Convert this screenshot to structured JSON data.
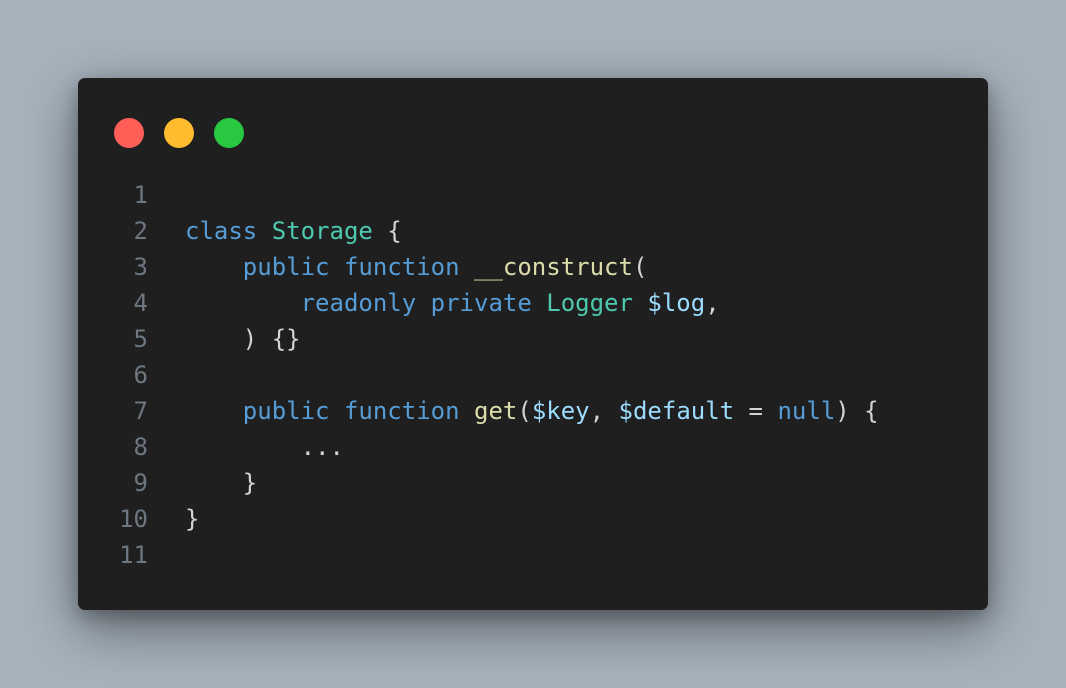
{
  "window": {
    "controls": {
      "close_color": "#ff5f57",
      "minimize_color": "#febc2e",
      "maximize_color": "#28c840"
    }
  },
  "theme": {
    "background": "#1f1f1f",
    "text": "#d4d4d4",
    "line_number": "#6e7681",
    "keyword": "#569cd6",
    "type": "#4ec9b0",
    "function": "#dcdcaa",
    "variable": "#9cdcfe"
  },
  "code": {
    "lines": [
      {
        "number": "1",
        "tokens": []
      },
      {
        "number": "2",
        "tokens": [
          {
            "t": "class",
            "k": "keyword"
          },
          {
            "t": " ",
            "k": "plain"
          },
          {
            "t": "Storage",
            "k": "type"
          },
          {
            "t": " {",
            "k": "plain"
          }
        ]
      },
      {
        "number": "3",
        "tokens": [
          {
            "t": "    ",
            "k": "plain"
          },
          {
            "t": "public",
            "k": "keyword"
          },
          {
            "t": " ",
            "k": "plain"
          },
          {
            "t": "function",
            "k": "keyword"
          },
          {
            "t": " ",
            "k": "plain"
          },
          {
            "t": "__construct",
            "k": "function"
          },
          {
            "t": "(",
            "k": "plain"
          }
        ]
      },
      {
        "number": "4",
        "tokens": [
          {
            "t": "        ",
            "k": "plain"
          },
          {
            "t": "readonly",
            "k": "keyword"
          },
          {
            "t": " ",
            "k": "plain"
          },
          {
            "t": "private",
            "k": "keyword"
          },
          {
            "t": " ",
            "k": "plain"
          },
          {
            "t": "Logger",
            "k": "type"
          },
          {
            "t": " ",
            "k": "plain"
          },
          {
            "t": "$log",
            "k": "variable"
          },
          {
            "t": ",",
            "k": "plain"
          }
        ]
      },
      {
        "number": "5",
        "tokens": [
          {
            "t": "    ) {}",
            "k": "plain"
          }
        ]
      },
      {
        "number": "6",
        "tokens": []
      },
      {
        "number": "7",
        "tokens": [
          {
            "t": "    ",
            "k": "plain"
          },
          {
            "t": "public",
            "k": "keyword"
          },
          {
            "t": " ",
            "k": "plain"
          },
          {
            "t": "function",
            "k": "keyword"
          },
          {
            "t": " ",
            "k": "plain"
          },
          {
            "t": "get",
            "k": "function"
          },
          {
            "t": "(",
            "k": "plain"
          },
          {
            "t": "$key",
            "k": "variable"
          },
          {
            "t": ", ",
            "k": "plain"
          },
          {
            "t": "$default",
            "k": "variable"
          },
          {
            "t": " = ",
            "k": "plain"
          },
          {
            "t": "null",
            "k": "keyword"
          },
          {
            "t": ") {",
            "k": "plain"
          }
        ]
      },
      {
        "number": "8",
        "tokens": [
          {
            "t": "        ...",
            "k": "plain"
          }
        ]
      },
      {
        "number": "9",
        "tokens": [
          {
            "t": "    }",
            "k": "plain"
          }
        ]
      },
      {
        "number": "10",
        "tokens": [
          {
            "t": "}",
            "k": "plain"
          }
        ]
      },
      {
        "number": "11",
        "tokens": []
      }
    ]
  }
}
